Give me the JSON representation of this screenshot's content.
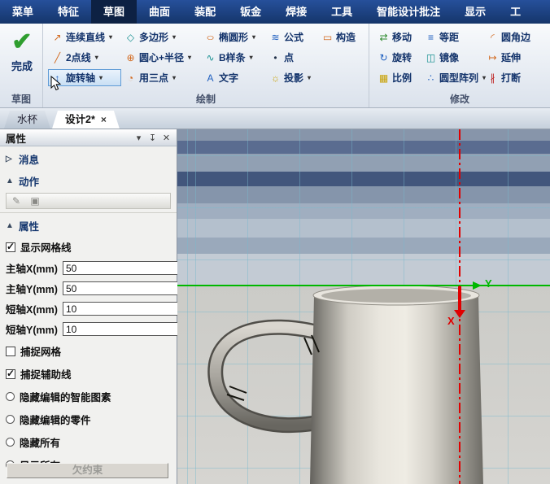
{
  "menu": {
    "items": [
      "菜单",
      "特征",
      "草图",
      "曲面",
      "装配",
      "钣金",
      "焊接",
      "工具",
      "智能设计批注",
      "显示",
      "工"
    ]
  },
  "ribbon": {
    "finish": {
      "glyph": "✔",
      "label": "完成",
      "group_label": "草图"
    },
    "draw": {
      "group_label": "绘制",
      "tools": {
        "continuous_line": {
          "label": "连续直线",
          "glyph": "↗"
        },
        "polygon": {
          "label": "多边形",
          "glyph": "◇"
        },
        "ellipse": {
          "label": "椭圆形",
          "glyph": "○"
        },
        "formula": {
          "label": "公式",
          "glyph": "≋"
        },
        "construct": {
          "label": "构造",
          "glyph": "▭"
        },
        "two_point_line": {
          "label": "2点线",
          "glyph": "╱"
        },
        "circle_center_radius": {
          "label": "圆心+半径",
          "glyph": "⊕"
        },
        "bspline": {
          "label": "B样条",
          "glyph": "∿"
        },
        "point": {
          "label": "点",
          "glyph": "•"
        },
        "rotation_axis": {
          "label": "旋转轴",
          "glyph": "↕"
        },
        "three_point": {
          "label": "用三点",
          "glyph": "◔"
        },
        "text": {
          "label": "文字",
          "glyph": "A"
        },
        "projection": {
          "label": "投影",
          "glyph": "☼"
        }
      }
    },
    "modify": {
      "group_label": "修改",
      "tools": {
        "move": {
          "label": "移动",
          "glyph": "⇄"
        },
        "offset": {
          "label": "等距",
          "glyph": "≡"
        },
        "fillet": {
          "label": "圆角边",
          "glyph": "◜"
        },
        "rotate": {
          "label": "旋转",
          "glyph": "↻"
        },
        "mirror": {
          "label": "镜像",
          "glyph": "◫"
        },
        "extend": {
          "label": "延伸",
          "glyph": "↦"
        },
        "scale": {
          "label": "比例",
          "glyph": "▦"
        },
        "circular_pattern": {
          "label": "圆型阵列",
          "glyph": "∴"
        },
        "break": {
          "label": "打断",
          "glyph": "∦"
        }
      }
    }
  },
  "tabs": {
    "items": [
      {
        "label": "水杯"
      },
      {
        "label": "设计2*"
      }
    ],
    "close_glyph": "×"
  },
  "panel": {
    "title": "属性",
    "header_icons": {
      "collapse": "▾",
      "pin": "↧",
      "close": "✕"
    },
    "sections": {
      "message": {
        "marker": "▷",
        "label": "消息"
      },
      "action": {
        "marker": "▲",
        "label": "动作"
      },
      "properties": {
        "marker": "▲",
        "label": "属性"
      }
    },
    "action_icons": {
      "edit": "✎",
      "select": "▣"
    },
    "checks": {
      "show_grid": {
        "label": "显示网格线",
        "checked": true
      },
      "snap_grid": {
        "label": "捕捉网格",
        "checked": false
      },
      "snap_guides": {
        "label": "捕捉辅助线",
        "checked": true
      }
    },
    "inputs": {
      "major_x": {
        "label": "主轴X(mm)",
        "value": "50"
      },
      "major_y": {
        "label": "主轴Y(mm)",
        "value": "50"
      },
      "minor_x": {
        "label": "短轴X(mm)",
        "value": "10"
      },
      "minor_y": {
        "label": "短轴Y(mm)",
        "value": "10"
      }
    },
    "radios": [
      {
        "label": "隐藏编辑的智能图素",
        "selected": false
      },
      {
        "label": "隐藏编辑的零件",
        "selected": false
      },
      {
        "label": "隐藏所有",
        "selected": false
      },
      {
        "label": "显示所有",
        "selected": true
      }
    ],
    "constraint_label": "欠约束"
  },
  "viewport": {
    "y_label": "Y",
    "x_label": "X",
    "colors": {
      "y_axis": "#00b800",
      "x_axis": "#e00000",
      "grid": "#8fc6d8"
    }
  }
}
